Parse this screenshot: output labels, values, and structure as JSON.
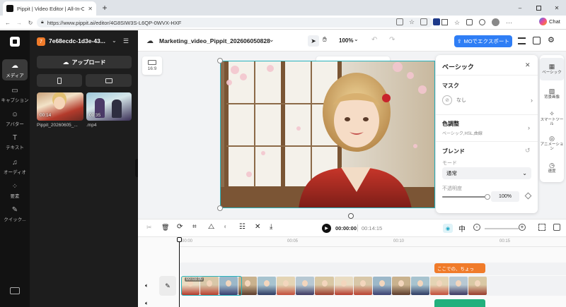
{
  "browser": {
    "tab_title": "Pippit | Video Editor | All-In-One V",
    "url": "https://www.pippit.ai/editor/4G8SIW3S-L6QP-0WVX-HXF",
    "chat_label": "Chat"
  },
  "sidebar": {
    "items": [
      {
        "label": "メディア",
        "icon": "cloud-icon"
      },
      {
        "label": "キャプション",
        "icon": "caption-icon"
      },
      {
        "label": "アバター",
        "icon": "avatar-icon"
      },
      {
        "label": "テキスト",
        "icon": "text-icon"
      },
      {
        "label": "オーディオ",
        "icon": "music-icon"
      },
      {
        "label": "要素",
        "icon": "elements-icon"
      },
      {
        "label": "クイック...",
        "icon": "quick-icon"
      }
    ]
  },
  "media": {
    "project_badge": "7",
    "project_name": "7e68ecdc-1d3e-43...",
    "upload_label": "アップロード",
    "files": [
      {
        "name": "Pippit_20260605_...",
        "duration": "00:14"
      },
      {
        "name": ".mp4",
        "duration": "00:35"
      }
    ]
  },
  "toolbar": {
    "project_title": "Marketing_video_Pippit_202606050828",
    "zoom": "100%",
    "export_label": "MOでエクスポート"
  },
  "canvas": {
    "aspect_ratio": "16:9"
  },
  "panel": {
    "title": "ベーシック",
    "mask_label": "マスク",
    "mask_value": "なし",
    "color_label": "色調整",
    "color_sub": "ベーシック,HSL,曲線",
    "blend_label": "ブレンド",
    "mode_label": "モード",
    "mode_value": "通常",
    "opacity_label": "不透明度",
    "opacity_value": "100%",
    "opacity_level": 1.0
  },
  "rightrail": {
    "items": [
      {
        "label": "ベーシック",
        "icon": "basic-icon"
      },
      {
        "label": "背景画像",
        "icon": "background-icon"
      },
      {
        "label": "スマートツール",
        "icon": "smart-tool-icon"
      },
      {
        "label": "アニメーション",
        "icon": "animation-icon"
      },
      {
        "label": "速度",
        "icon": "speed-icon"
      }
    ]
  },
  "playback": {
    "current_time": "00:00:00",
    "total_time": "00:14:15"
  },
  "timeline": {
    "ruler": [
      "00:00",
      "00:05",
      "00:10",
      "00:15"
    ],
    "text_clip": "ここでの、ちょっ",
    "clip_duration": "00:03:00"
  },
  "colors": {
    "accent": "#2f7ef5",
    "selection": "#27b3bd",
    "text_clip": "#f07b2a",
    "sidebar_bg": "#121212"
  }
}
